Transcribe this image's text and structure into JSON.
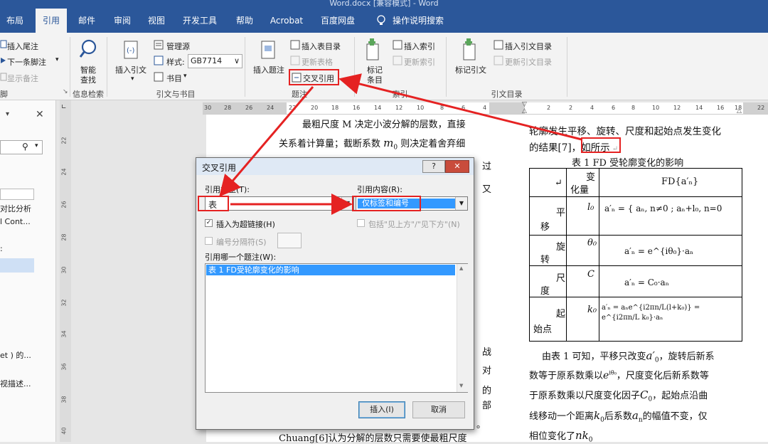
{
  "window": {
    "title": "Word.docx [兼容模式] - Word"
  },
  "tabs": [
    "布局",
    "引用",
    "邮件",
    "审阅",
    "视图",
    "开发工具",
    "帮助",
    "Acrobat",
    "百度网盘",
    "操作说明搜索"
  ],
  "ribbon": {
    "footnotes": {
      "insert_endnote": "插入尾注",
      "next_footnote": "下一条脚注",
      "show_notes": "显示备注",
      "group_label": "脚注"
    },
    "research": {
      "smart_lookup": "智能",
      "smart_lookup2": "查找",
      "group_label": "信息检索"
    },
    "citations": {
      "insert_citation": "插入引文",
      "manage_sources": "管理源",
      "style_label": "样式:",
      "style_value": "GB7714",
      "bibliography": "书目",
      "group_label": "引文与书目"
    },
    "captions": {
      "insert_caption": "插入题注",
      "insert_table_of_figures": "插入表目录",
      "update_table": "更新表格",
      "cross_reference": "交叉引用",
      "group_label": "题注"
    },
    "index": {
      "mark_entry": "标记",
      "mark_entry2": "条目",
      "insert_index": "插入索引",
      "update_index": "更新索引",
      "group_label": "索引"
    },
    "toa": {
      "mark_citation": "标记引文",
      "insert_toa": "插入引文目录",
      "update_toa": "更新引文目录",
      "group_label": "引文目录"
    }
  },
  "navpane": {
    "items": [
      "对比分析",
      "l Cont...",
      "et ) 的...",
      "视描述..."
    ]
  },
  "vruler_nums": [
    "22",
    "24",
    "26",
    "28",
    "30",
    "32",
    "34",
    "36",
    "38",
    "40"
  ],
  "hruler_nums": [
    "30",
    "28",
    "26",
    "24",
    "22",
    "20",
    "18",
    "16",
    "14",
    "12",
    "10",
    "8",
    "6",
    "4",
    "2",
    "2",
    "4",
    "6",
    "8",
    "10",
    "12",
    "14",
    "16",
    "18",
    "22"
  ],
  "document": {
    "left": {
      "line1": "最粗尺度 M 决定小波分解的层数，直接",
      "line2a": "关系着计算量；截断系数 ",
      "line2m": "m",
      "line2sub": "0",
      "line2b": " 则决定着舍弃细",
      "side1": "过",
      "side2": "又",
      "side3": "战",
      "side4": "对",
      "side5": "的",
      "side6": "部",
      "side7": "。",
      "bottom": "Chuang[6]认为分解的层数只需要使最粗尺度"
    },
    "right": {
      "line1": "轮廓发生平移、旋转、尺度和起始点发生变化",
      "line2a": "的结果[7]，",
      "line2ref": "如所示",
      "caption": "表 1 FD 受轮廓变化的影响",
      "para1a": "由表 1 可知，平移只改变",
      "para2a": "数等于原系数乘以",
      "para2b": "，尺度变化后新系数等",
      "para3a": "于原系数乘以尺度变化因子",
      "para3b": "，起始点沿曲",
      "para4a": "线移动一个距离",
      "para4b": "后系数",
      "para4c": "的幅值不变，仅",
      "para5a": "相位变化了",
      "para1b": "，旋转后新系"
    },
    "table": {
      "header": {
        "c1a": "变",
        "c1b": "化量",
        "c2": "FD{a′ₙ}"
      },
      "rows": [
        {
          "label1": "平",
          "label2": "移",
          "var": "l₀",
          "formula": "a′ₙ = { aₙ, n≠0 ; aₙ+l₀, n=0"
        },
        {
          "label1": "旋",
          "label2": "转",
          "var": "θ₀",
          "formula": "a′ₙ = e^{iθ₀}·aₙ"
        },
        {
          "label1": "尺",
          "label2": "度",
          "var": "C",
          "formula": "a′ₙ = C₀·aₙ"
        },
        {
          "label1": "起",
          "label2": "始点",
          "var": "k₀",
          "formula": "a′ₙ = aₙe^{i2πn/L(l+k₀)} = e^{i2πn/L k₀}·aₙ"
        }
      ]
    }
  },
  "dialog": {
    "title": "交叉引用",
    "help": "?",
    "ref_type_label": "引用类型(T):",
    "ref_type_value": "表",
    "ref_content_label": "引用内容(R):",
    "ref_content_value": "仅标签和编号",
    "insert_hyperlink": "插入为超链接(H)",
    "include_above_below": "包括\"见上方\"/\"见下方\"(N)",
    "separate_numbers": "编号分隔符(S)",
    "which_caption_label": "引用哪一个题注(W):",
    "caption_item": "表 1 FD受轮廓变化的影响",
    "insert_button": "插入(I)",
    "cancel_button": "取消"
  },
  "colors": {
    "ribbon_blue": "#2b579a",
    "annotation_red": "#e52222",
    "selection_blue": "#3399ff"
  }
}
